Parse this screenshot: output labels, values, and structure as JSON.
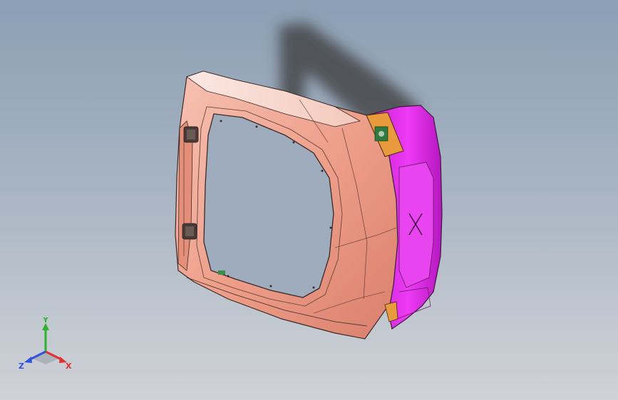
{
  "viewport": {
    "background_top": "#8c9fb4",
    "background_bottom": "#cfd2d6"
  },
  "model": {
    "parts": [
      {
        "name": "door-frame-panel",
        "color": "#f0a08c"
      },
      {
        "name": "door-end-cap",
        "color": "#e030e8"
      },
      {
        "name": "hinge-bracket",
        "color": "#e89a3c"
      },
      {
        "name": "mount-clip",
        "color": "#3c8c4c"
      }
    ],
    "shadow_color": "#3a3a3a"
  },
  "triad": {
    "x_label": "X",
    "y_label": "Y",
    "z_label": "Z",
    "x_color": "#e03030",
    "y_color": "#30b030",
    "z_color": "#3050e0"
  }
}
